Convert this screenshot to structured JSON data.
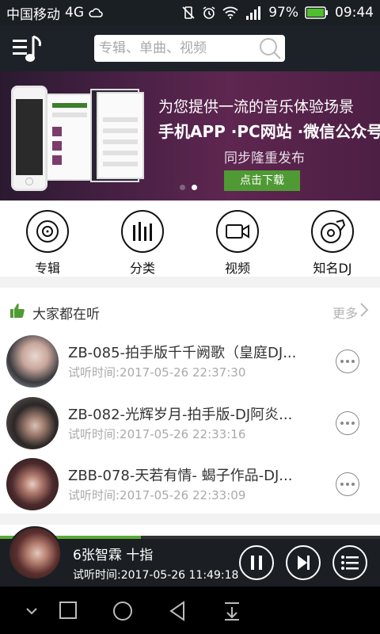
{
  "status": {
    "carrier": "中国移动",
    "network": "4G",
    "battery": "97%",
    "time": "09:44"
  },
  "search": {
    "placeholder": "专辑、单曲、视频"
  },
  "banner": {
    "line1": "为您提供一流的音乐体验场景",
    "line2": "手机APP ·PC网站 ·微信公众号",
    "line3": "同步隆重发布",
    "download_label": "点击下载",
    "active_dot": 1
  },
  "quick_nav": [
    {
      "label": "专辑",
      "icon": "album-icon"
    },
    {
      "label": "分类",
      "icon": "category-icon"
    },
    {
      "label": "视频",
      "icon": "video-icon"
    },
    {
      "label": "知名DJ",
      "icon": "dj-icon"
    }
  ],
  "section": {
    "title": "大家都在听",
    "more": "更多"
  },
  "tracks": [
    {
      "title": "ZB-085-拍手版千千阙歌（皇庭DJ...",
      "time": "试听时间:2017-05-26 22:37:30"
    },
    {
      "title": "ZB-082-光辉岁月-拍手版-DJ阿炎...",
      "time": "试听时间:2017-05-26 22:33:16"
    },
    {
      "title": "ZBB-078-天若有情- 蝎子作品-DJ...",
      "time": "试听时间:2017-05-26 22:33:09"
    }
  ],
  "player": {
    "title": "6张智霖 十指",
    "time": "试听时间:2017-05-26 11:49:18",
    "progress": 0.37
  },
  "colors": {
    "accent": "#5aab35",
    "header": "#1c2227",
    "banner": "#4a2146"
  }
}
